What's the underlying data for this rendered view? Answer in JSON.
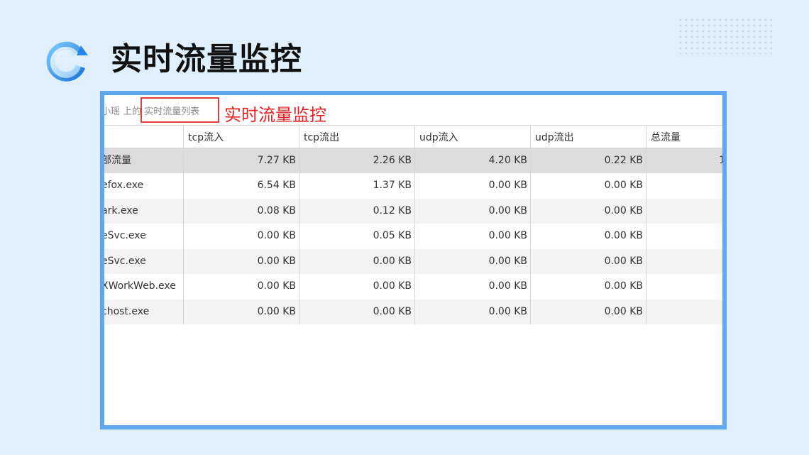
{
  "page": {
    "heading": "实时流量监控",
    "accent": "#5fa8f0"
  },
  "logo": {
    "icon": "circular-arrow-logo-icon"
  },
  "window": {
    "title_partial": "小瑶 上的 实时流量列表",
    "annotation": "实时流量监控"
  },
  "table": {
    "headers": [
      "",
      "tcp流入",
      "tcp流出",
      "udp流入",
      "udp流出",
      "总流量"
    ],
    "rows": [
      {
        "name": "部流量",
        "tcp_in": "7.27 KB",
        "tcp_out": "2.26 KB",
        "udp_in": "4.20 KB",
        "udp_out": "0.22 KB",
        "total": "1"
      },
      {
        "name": "efox.exe",
        "tcp_in": "6.54 KB",
        "tcp_out": "1.37 KB",
        "udp_in": "0.00 KB",
        "udp_out": "0.00 KB",
        "total": ""
      },
      {
        "name": "ark.exe",
        "tcp_in": "0.08 KB",
        "tcp_out": "0.12 KB",
        "udp_in": "0.00 KB",
        "udp_out": "0.00 KB",
        "total": ""
      },
      {
        "name": "eSvc.exe",
        "tcp_in": "0.00 KB",
        "tcp_out": "0.05 KB",
        "udp_in": "0.00 KB",
        "udp_out": "0.00 KB",
        "total": ""
      },
      {
        "name": "eSvc.exe",
        "tcp_in": "0.00 KB",
        "tcp_out": "0.00 KB",
        "udp_in": "0.00 KB",
        "udp_out": "0.00 KB",
        "total": ""
      },
      {
        "name": "XWorkWeb.exe",
        "tcp_in": "0.00 KB",
        "tcp_out": "0.00 KB",
        "udp_in": "0.00 KB",
        "udp_out": "0.00 KB",
        "total": ""
      },
      {
        "name": "chost.exe",
        "tcp_in": "0.00 KB",
        "tcp_out": "0.00 KB",
        "udp_in": "0.00 KB",
        "udp_out": "0.00 KB",
        "total": ""
      }
    ]
  }
}
